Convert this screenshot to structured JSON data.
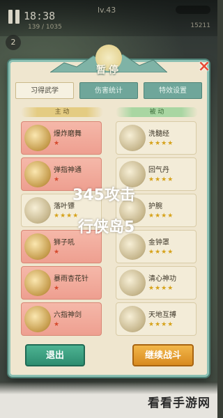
{
  "hud": {
    "timer": "18:38",
    "subtext": "139 / 1035",
    "level": "lv.43",
    "right_value": "15211",
    "left_badge": "2"
  },
  "dialog": {
    "title": "暂停",
    "close_label": "×",
    "tabs": [
      {
        "label": "习得武学",
        "active": true
      },
      {
        "label": "伤害统计",
        "active": false
      },
      {
        "label": "特效设置",
        "active": false
      }
    ],
    "active_header": "主 动",
    "passive_header": "被 动",
    "active_skills": [
      {
        "name": "爆炸磨舞",
        "stars": "★"
      },
      {
        "name": "弹指神通",
        "stars": "★"
      },
      {
        "name": "落叶镖",
        "stars": "★★★★"
      },
      {
        "name": "狮子吼",
        "stars": "★"
      },
      {
        "name": "暴雨杏花针",
        "stars": "★"
      },
      {
        "name": "六指神剑",
        "stars": "★"
      }
    ],
    "passive_skills": [
      {
        "name": "洗髓经",
        "stars": "★★★★"
      },
      {
        "name": "回气丹",
        "stars": "★★★★"
      },
      {
        "name": "护腕",
        "stars": "★★★★"
      },
      {
        "name": "金钟罩",
        "stars": "★★★★"
      },
      {
        "name": "清心神功",
        "stars": "★★★★"
      },
      {
        "name": "天地互搏",
        "stars": "★★★★"
      }
    ],
    "exit_label": "退出",
    "continue_label": "继续战斗"
  },
  "overlay": {
    "line1": "345攻击",
    "line2": "行侠岛5"
  },
  "watermark": "看看手游网",
  "colors": {
    "panel_border": "#8cc0b3",
    "active_skill": "#ee9f90",
    "passive_skill": "#f3ecd8",
    "exit_button": "#2e8d70",
    "continue_button": "#d88a1f"
  }
}
